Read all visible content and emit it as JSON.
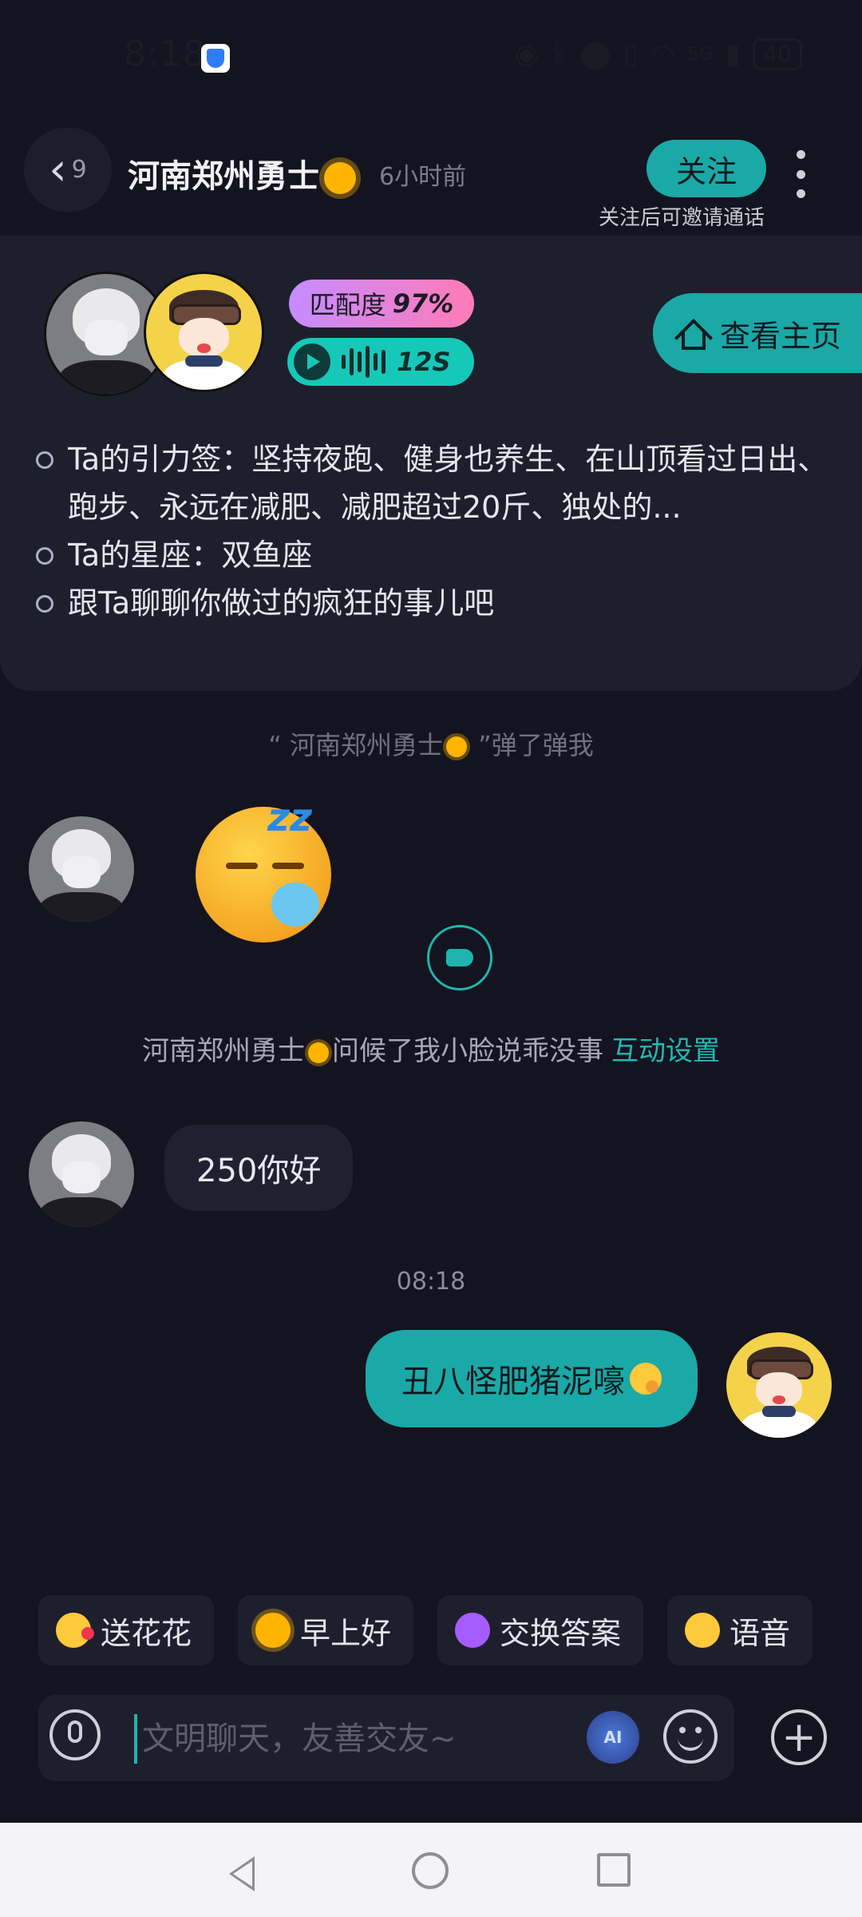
{
  "status_bar": {
    "time": "8:18",
    "icons": [
      "shield-icon",
      "eye-icon",
      "bluetooth-icon",
      "location-icon",
      "vibrate-icon",
      "wifi-icon",
      "signal-5g-icon"
    ],
    "signal_label": "5G",
    "battery": "40"
  },
  "header": {
    "back_count": "9",
    "peer_name": "河南郑州勇士",
    "peer_time": "6小时前",
    "follow_label": "关注",
    "follow_hint": "关注后可邀请通话"
  },
  "match_card": {
    "match_label": "匹配度",
    "match_value": "97%",
    "voice_duration": "12S",
    "home_label": "查看主页",
    "info": [
      "Ta的引力签：坚持夜跑、健身也养生、在山顶看过日出、跑步、永远在减肥、减肥超过20斤、独处的...",
      "Ta的星座：双鱼座",
      "跟Ta聊聊你做过的疯狂的事儿吧"
    ]
  },
  "chat": {
    "poke_prefix": "“ 河南郑州勇士",
    "poke_suffix": " ”弹了弹我",
    "greet_text_name": "河南郑州勇士",
    "greet_text_rest": "问候了我小脸说乖没事",
    "greet_link": "互动设置",
    "incoming_message": "250你好",
    "timestamp": "08:18",
    "outgoing_message": "丑八怪肥猪泥嚎"
  },
  "quick_replies": [
    "送花花",
    "早上好",
    "交换答案",
    "语音"
  ],
  "input": {
    "placeholder": "文明聊天，友善交友~",
    "value": "",
    "ai_label": "AI"
  },
  "colors": {
    "accent": "#1aa9a7",
    "background": "#13141f",
    "card": "#1e1f2c"
  }
}
